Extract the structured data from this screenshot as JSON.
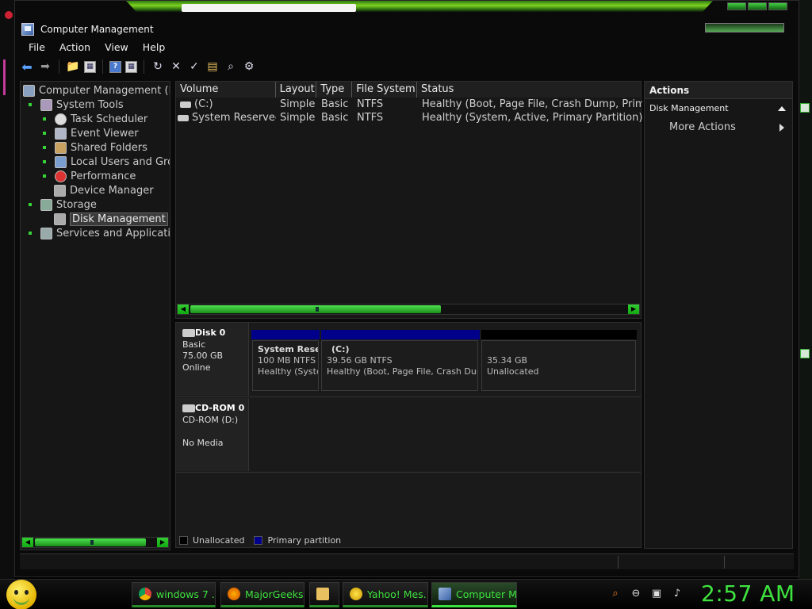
{
  "window": {
    "title": "Computer Management"
  },
  "menu": [
    "File",
    "Action",
    "View",
    "Help"
  ],
  "tree": {
    "root": "Computer Management (Loc",
    "system_tools": "System Tools",
    "task_scheduler": "Task Scheduler",
    "event_viewer": "Event Viewer",
    "shared_folders": "Shared Folders",
    "local_users": "Local Users and Grou",
    "performance": "Performance",
    "device_manager": "Device Manager",
    "storage": "Storage",
    "disk_management": "Disk Management",
    "services": "Services and Applications"
  },
  "list": {
    "columns": [
      "Volume",
      "Layout",
      "Type",
      "File System",
      "Status"
    ],
    "rows": [
      {
        "volume": "(C:)",
        "layout": "Simple",
        "type": "Basic",
        "fs": "NTFS",
        "status": "Healthy (Boot, Page File, Crash Dump, Primary"
      },
      {
        "volume": "System Reserved",
        "layout": "Simple",
        "type": "Basic",
        "fs": "NTFS",
        "status": "Healthy (System, Active, Primary Partition)"
      }
    ]
  },
  "disks": {
    "disk0": {
      "name": "Disk 0",
      "type": "Basic",
      "size": "75.00 GB",
      "state": "Online"
    },
    "cdrom0": {
      "name": "CD-ROM 0",
      "drive": "CD-ROM (D:)",
      "state": "No Media"
    },
    "partitions": [
      {
        "name": "System Rese",
        "size": "100 MB NTFS",
        "status": "Healthy (Syste"
      },
      {
        "name": "(C:)",
        "size": "39.56 GB NTFS",
        "status": "Healthy (Boot, Page File, Crash Dump,"
      },
      {
        "name": "",
        "size": "35.34 GB",
        "status": "Unallocated"
      }
    ]
  },
  "legend": {
    "unallocated": "Unallocated",
    "primary": "Primary partition",
    "unallocated_color": "#000000",
    "primary_color": "#00008b"
  },
  "actions": {
    "header": "Actions",
    "section": "Disk Management",
    "more": "More Actions"
  },
  "taskbar": {
    "items": [
      "windows 7 ...",
      "MajorGeeks...",
      "",
      "Yahoo! Mes...",
      "Computer M..."
    ],
    "clock": "2:57 AM"
  },
  "colors": {
    "accent": "#3ee23e"
  }
}
